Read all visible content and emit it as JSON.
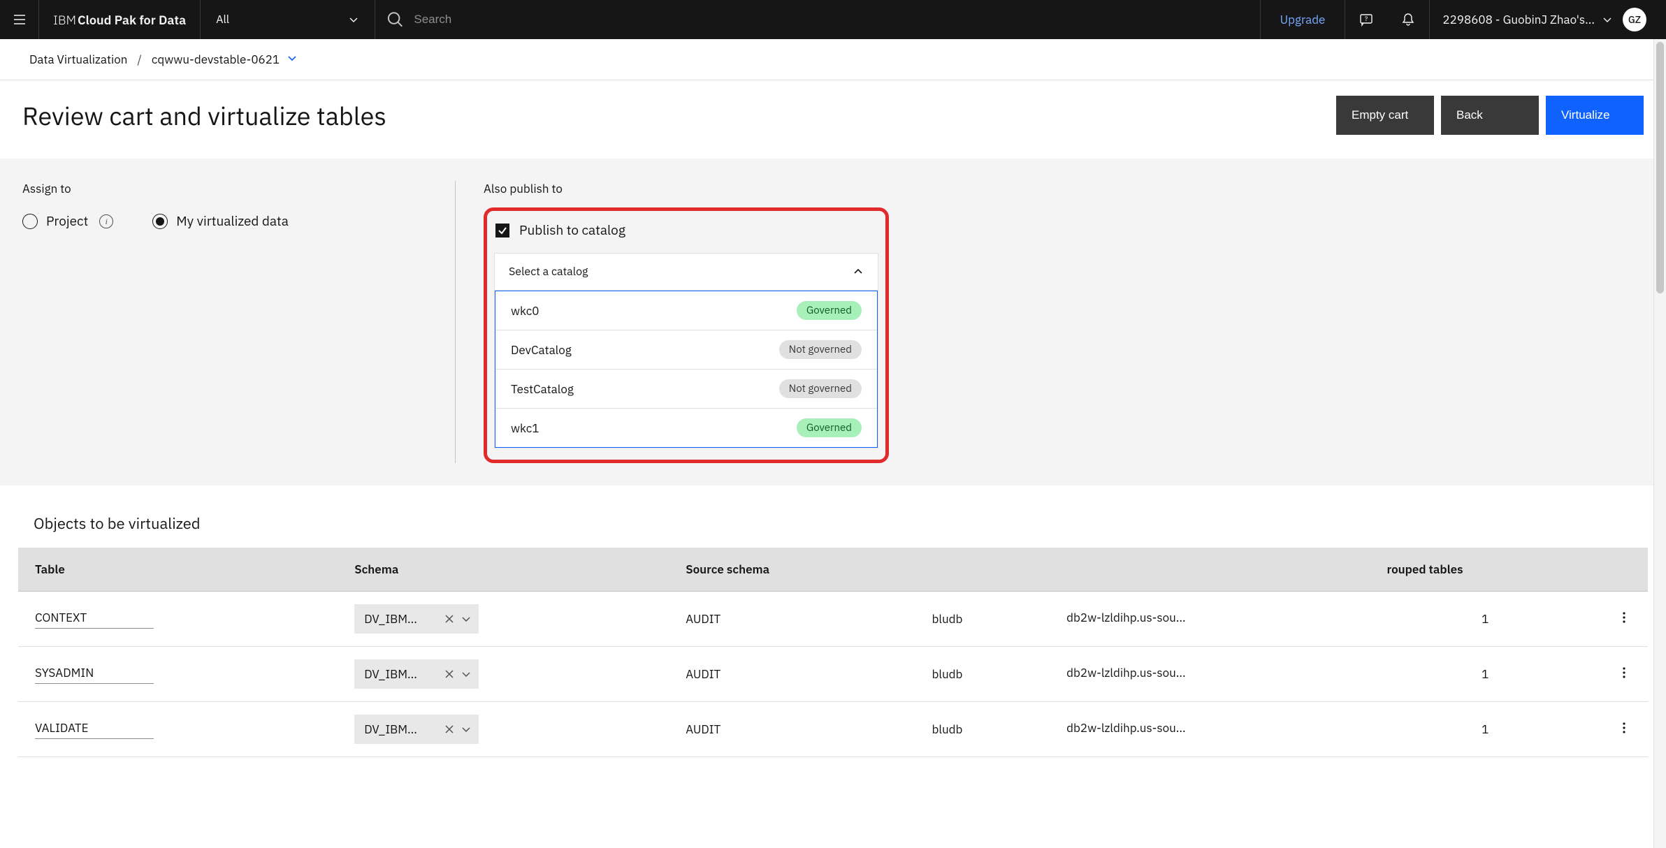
{
  "topbar": {
    "brand_prefix": "IBM ",
    "brand_main": "Cloud Pak for Data",
    "scope_label": "All",
    "search_placeholder": "Search",
    "upgrade_label": "Upgrade",
    "account_label": "2298608 - GuobinJ Zhao's...",
    "avatar_initials": "GZ"
  },
  "breadcrumbs": {
    "item1": "Data Virtualization",
    "item2": "cqwwu-devstable-0621"
  },
  "page": {
    "title": "Review cart and virtualize tables"
  },
  "buttons": {
    "empty_cart": "Empty cart",
    "back": "Back",
    "virtualize": "Virtualize"
  },
  "assign": {
    "label": "Assign to",
    "project": "Project",
    "my_virtualized": "My virtualized data"
  },
  "publish": {
    "label": "Also publish to",
    "checkbox_label": "Publish to catalog",
    "select_placeholder": "Select a catalog",
    "options": [
      {
        "name": "wkc0",
        "governed": true,
        "badge": "Governed"
      },
      {
        "name": "DevCatalog",
        "governed": false,
        "badge": "Not governed"
      },
      {
        "name": "TestCatalog",
        "governed": false,
        "badge": "Not governed"
      },
      {
        "name": "wkc1",
        "governed": true,
        "badge": "Governed"
      }
    ]
  },
  "objects": {
    "title": "Objects to be virtualized",
    "columns": {
      "table": "Table",
      "schema": "Schema",
      "source_schema": "Source schema",
      "source_db": "bludb",
      "source_host": "db2w-lzldihp.us-sou...",
      "grouped": "rouped tables"
    },
    "rows": [
      {
        "table": "CONTEXT",
        "schema": "DV_IBM...",
        "source_schema": "AUDIT",
        "source_db": "bludb",
        "source_host": "db2w-lzldihp.us-sou...",
        "grouped": "1"
      },
      {
        "table": "SYSADMIN",
        "schema": "DV_IBM...",
        "source_schema": "AUDIT",
        "source_db": "bludb",
        "source_host": "db2w-lzldihp.us-sou...",
        "grouped": "1"
      },
      {
        "table": "VALIDATE",
        "schema": "DV_IBM...",
        "source_schema": "AUDIT",
        "source_db": "bludb",
        "source_host": "db2w-lzldihp.us-sou...",
        "grouped": "1"
      }
    ]
  }
}
